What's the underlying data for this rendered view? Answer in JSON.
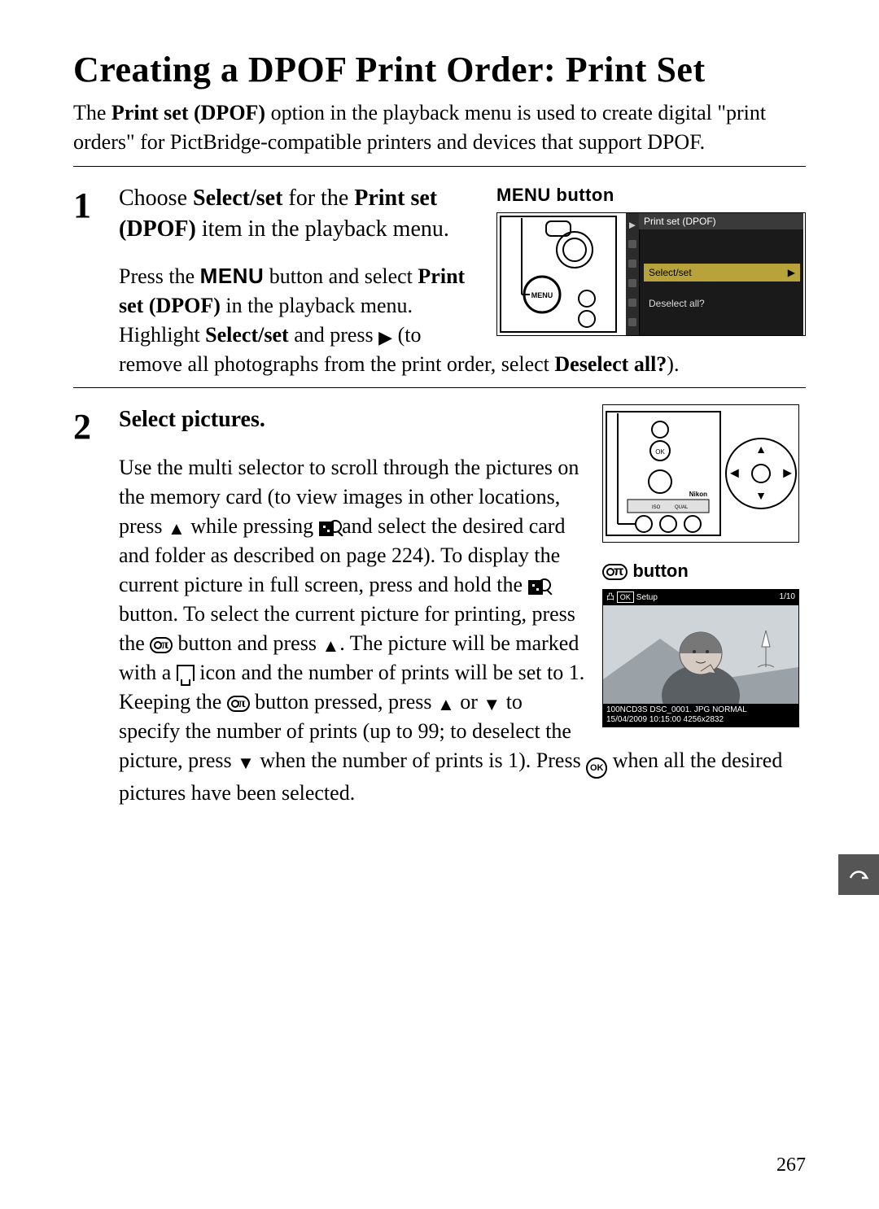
{
  "title": "Creating a DPOF Print Order: Print Set",
  "intro": {
    "a": "The ",
    "b_bold": "Print set (DPOF)",
    "c": " option in the playback menu is used to create digital \"print orders\" for PictBridge-compatible printers and devices that support DPOF."
  },
  "step1": {
    "num": "1",
    "head_a": "Choose ",
    "head_b": "Select/set",
    "head_c": " for the ",
    "head_d": "Print set (DPOF)",
    "head_e": " item in the playback menu.",
    "fig_caption": "MENU button",
    "lcd": {
      "header": "Print set (DPOF)",
      "item_sel": "Select/set",
      "item_des": "Deselect all?"
    },
    "p_a": "Press the ",
    "p_menu": "MENU",
    "p_b": " button and select ",
    "p_bold1": "Print set (DPOF)",
    "p_c": " in the playback menu.  Highlight ",
    "p_bold2": "Select/set",
    "p_d": " and press ",
    "p_e": " (to remove all photographs from the print order, select ",
    "p_bold3": "Deselect all?",
    "p_f": ")."
  },
  "step2": {
    "num": "2",
    "head": "Select pictures.",
    "fig_caption2": " button",
    "thumb": {
      "top_setup": "Setup",
      "top_ok": "OK",
      "top_count": "1/10",
      "bot_line1": "100NCD3S  DSC_0001. JPG        NORMAL",
      "bot_line2": "15/04/2009  10:15:00       4256x2832"
    },
    "p1": "Use the multi selector to scroll through the pictures on the memory card (to view images in other locations, press ",
    "p2": " while pressing ",
    "p3": " and select the desired card and folder as described on page 224).  To display the current picture in full screen, press and hold the ",
    "p4": " button.  To select the current picture for printing, press the ",
    "p5": " button and press ",
    "p6": ".  The picture will be marked with a ",
    "p7": " icon and the number of prints will be set to 1.  Keeping the ",
    "p8": " button pressed, press ",
    "p9": " or ",
    "p10": " to specify the number of prints (up to 99; to deselect the picture, press ",
    "p11": " when the number of prints is 1).  Press ",
    "p12": " when all the desired pictures have been selected."
  },
  "ok_label": "OK",
  "page_number": "267"
}
